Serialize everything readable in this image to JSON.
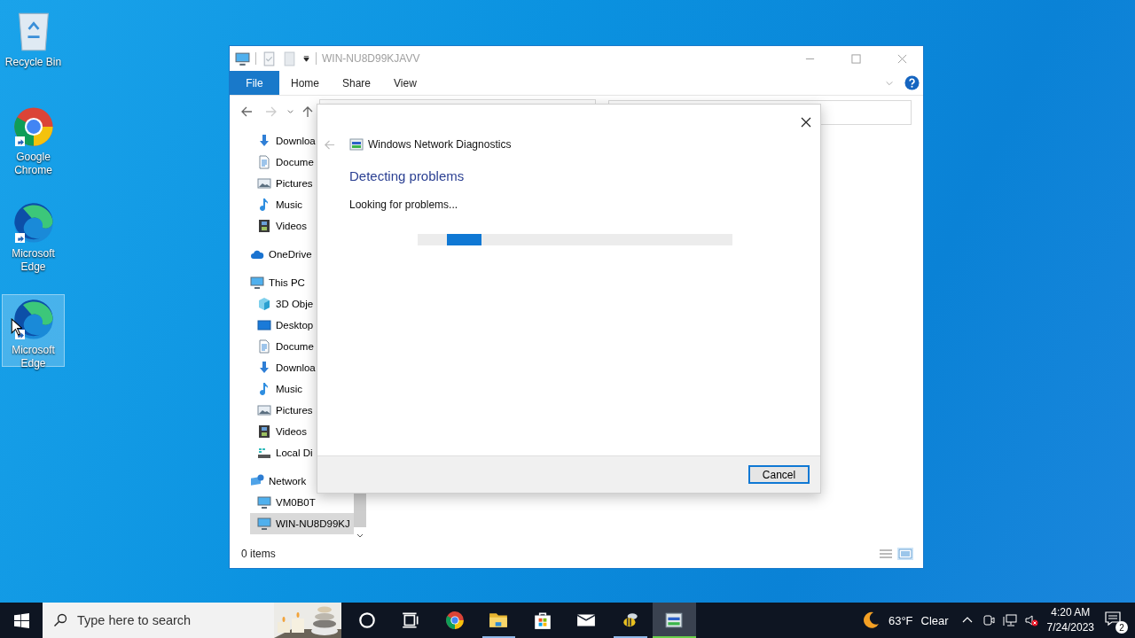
{
  "desktop_icons": [
    {
      "label": "Recycle Bin",
      "kind": "recycle-bin",
      "shortcut": false,
      "selected": false
    },
    {
      "label": "Google Chrome",
      "kind": "chrome",
      "shortcut": true,
      "selected": false
    },
    {
      "label": "Microsoft Edge",
      "kind": "edge",
      "shortcut": true,
      "selected": false
    },
    {
      "label": "Microsoft Edge",
      "kind": "edge",
      "shortcut": true,
      "selected": true
    }
  ],
  "explorer": {
    "title": "WIN-NU8D99KJAVV",
    "file_tab": "File",
    "ribbon_tabs": [
      "Home",
      "Share",
      "View"
    ],
    "nav_pane": {
      "quick_access": [
        {
          "label": "Downloa",
          "kind": "download",
          "selected": false
        },
        {
          "label": "Docume",
          "kind": "document",
          "selected": false
        },
        {
          "label": "Pictures",
          "kind": "pictures",
          "selected": false
        },
        {
          "label": "Music",
          "kind": "music",
          "selected": false
        },
        {
          "label": "Videos",
          "kind": "videos",
          "selected": false
        }
      ],
      "tree": [
        {
          "label": "OneDrive",
          "kind": "onedrive",
          "selected": false
        },
        {
          "label": "This PC",
          "kind": "pc",
          "selected": false,
          "children": [
            {
              "label": "3D Obje",
              "kind": "objects3d",
              "selected": false
            },
            {
              "label": "Desktop",
              "kind": "desktop",
              "selected": false
            },
            {
              "label": "Docume",
              "kind": "document",
              "selected": false
            },
            {
              "label": "Downloa",
              "kind": "download",
              "selected": false
            },
            {
              "label": "Music",
              "kind": "music",
              "selected": false
            },
            {
              "label": "Pictures",
              "kind": "pictures",
              "selected": false
            },
            {
              "label": "Videos",
              "kind": "videos",
              "selected": false
            },
            {
              "label": "Local Di",
              "kind": "disk",
              "selected": false
            }
          ]
        },
        {
          "label": "Network",
          "kind": "network",
          "selected": false,
          "children": [
            {
              "label": "VM0B0T",
              "kind": "computer",
              "selected": false
            },
            {
              "label": "WIN-NU8D99KJ",
              "kind": "computer",
              "selected": true
            }
          ]
        }
      ]
    },
    "status": "0 items"
  },
  "dialog": {
    "title": "Windows Network Diagnostics",
    "heading": "Detecting problems",
    "status": "Looking for problems...",
    "progress": {
      "indeterminate": true
    },
    "buttons": [
      "Cancel"
    ]
  },
  "taskbar": {
    "search": {
      "placeholder": "Type here to search"
    },
    "apps": [
      {
        "kind": "cortana",
        "running": false,
        "selected": false
      },
      {
        "kind": "task-view",
        "running": false,
        "selected": false
      },
      {
        "kind": "chrome",
        "running": false,
        "selected": false
      },
      {
        "kind": "folder",
        "running": true,
        "selected": false
      },
      {
        "kind": "store",
        "running": false,
        "selected": false
      },
      {
        "kind": "mail",
        "running": false,
        "selected": false
      },
      {
        "kind": "bee",
        "running": true,
        "selected": false
      },
      {
        "kind": "diagnostics",
        "running": true,
        "selected": true
      }
    ],
    "weather": {
      "temperature": "63°F",
      "condition": "Clear"
    },
    "time": "4:20 AM",
    "date": "7/24/2023",
    "notifications": "2"
  }
}
